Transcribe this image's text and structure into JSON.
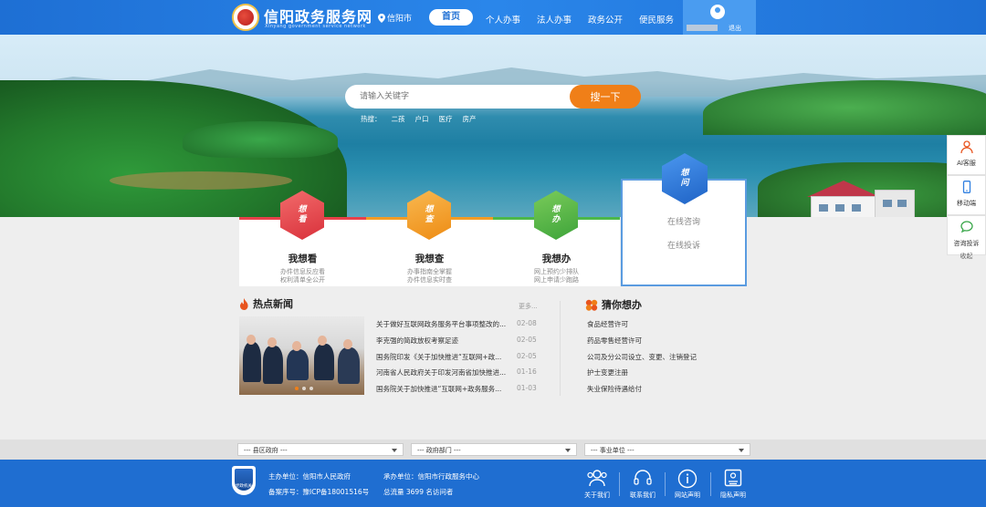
{
  "header": {
    "site_title": "信阳政务服务网",
    "site_subtitle": "Xinyang government service network",
    "location": "信阳市",
    "nav": [
      "首页",
      "个人办事",
      "法人办事",
      "政务公开",
      "便民服务"
    ],
    "logout": "退出"
  },
  "search": {
    "placeholder": "请输入关键字",
    "button": "搜一下",
    "hot_label": "热搜：",
    "hot_words": [
      "二孩",
      "户口",
      "医疗",
      "房产"
    ]
  },
  "cards": [
    {
      "icon_text": [
        "想",
        "看"
      ],
      "title": "我想看",
      "desc1": "办件信息反应看",
      "desc2": "权利清单全公开",
      "color": "#e8414a"
    },
    {
      "icon_text": [
        "想",
        "查"
      ],
      "title": "我想查",
      "desc1": "办事指南全掌握",
      "desc2": "办件信息实时查",
      "color": "#f39c24"
    },
    {
      "icon_text": [
        "想",
        "办"
      ],
      "title": "我想办",
      "desc1": "网上预约少排队",
      "desc2": "网上申请少跑路",
      "color": "#4cb84a"
    }
  ],
  "ask_card": {
    "icon_text": [
      "想",
      "问"
    ],
    "links": [
      "在线咨询",
      "在线投诉"
    ],
    "color": "#2f7fe0"
  },
  "news": {
    "title": "热点新闻",
    "more": "更多...",
    "items": [
      {
        "title": "关于做好互联网政务服务平台事项整改的...",
        "date": "02-08"
      },
      {
        "title": "李克强的简政放权考察足迹",
        "date": "02-05"
      },
      {
        "title": "国务院印发《关于加快推进“互联网+政...",
        "date": "02-05"
      },
      {
        "title": "河南省人民政府关于印发河南省加快推进...",
        "date": "01-16"
      },
      {
        "title": "国务院关于加快推进“互联网+政务服务...",
        "date": "01-03"
      }
    ]
  },
  "guess": {
    "title": "猜你想办",
    "items": [
      "食品经营许可",
      "药品零售经营许可",
      "公司及分公司设立、变更、注销登记",
      "护士变更注册",
      "失业保险待遇给付"
    ]
  },
  "side_float": {
    "items": [
      "AI客服",
      "移动端",
      "咨询投诉"
    ],
    "fold": "收起"
  },
  "selects": [
    "--- 县区政府 ---",
    "--- 政府部门 ---",
    "--- 事业单位 ---"
  ],
  "footer": {
    "badge_text": "党政机关",
    "sponsor": "主办单位：信阳市人民政府",
    "organizer": "承办单位：信阳市行政服务中心",
    "icp": "备案序号：豫ICP备18001516号",
    "visits": "总流量 3699 名访问者",
    "links": [
      "关于我们",
      "联系我们",
      "网站声明",
      "隐私声明"
    ]
  },
  "colors": {
    "header_blue": "#1e6fd4",
    "accent_orange": "#f07f18",
    "footer_blue": "#1f6ed1"
  }
}
